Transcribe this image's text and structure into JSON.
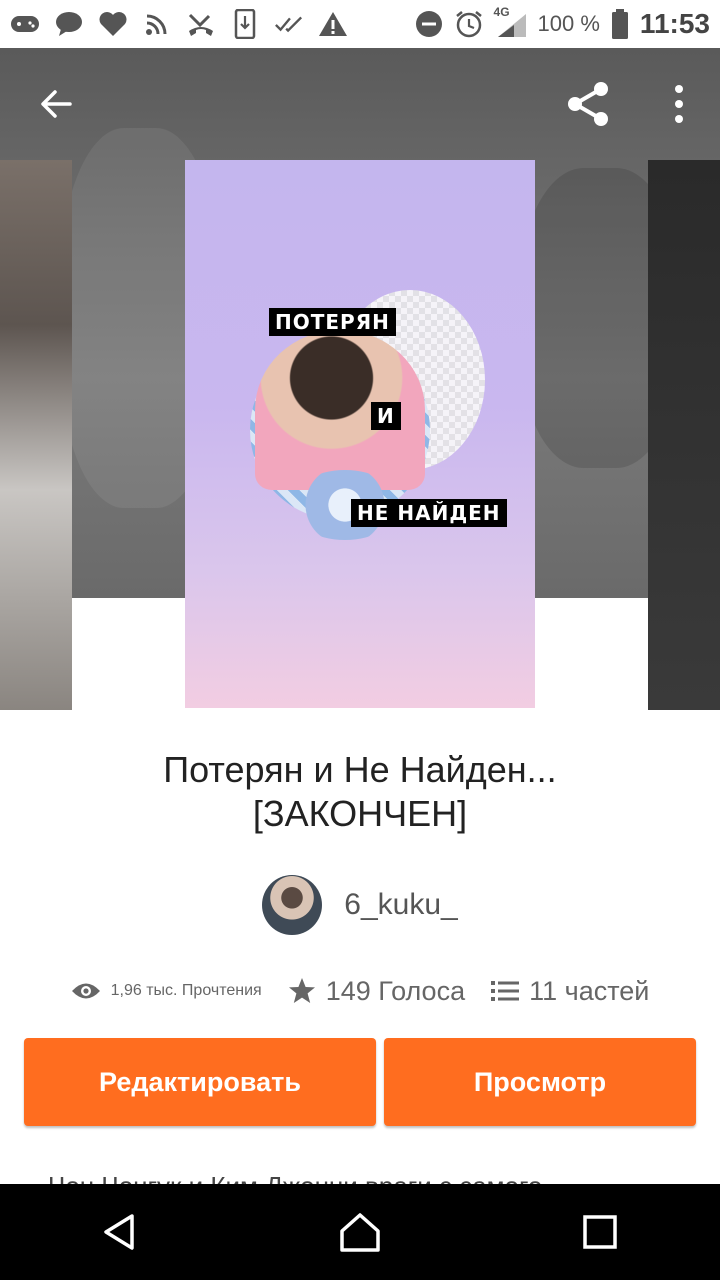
{
  "status_bar": {
    "network": "4G",
    "battery": "100 %",
    "time": "11:53"
  },
  "cover": {
    "label_top": "ПОТЕРЯН",
    "label_mid": "И",
    "label_bottom": "НЕ НАЙДЕН"
  },
  "story": {
    "title": "Потерян и Не Найден... [ЗАКОНЧЕН]",
    "author": "6_kuku_",
    "reads": "1,96 тыс. Прочтения",
    "votes": "149 Голоса",
    "parts": "11 частей",
    "description": "Чон Чонгук и Ким Джонни враги с самого"
  },
  "buttons": {
    "edit": "Редактировать",
    "view": "Просмотр"
  },
  "colors": {
    "accent": "#ff6d1f",
    "nav_bar": "#000000"
  }
}
